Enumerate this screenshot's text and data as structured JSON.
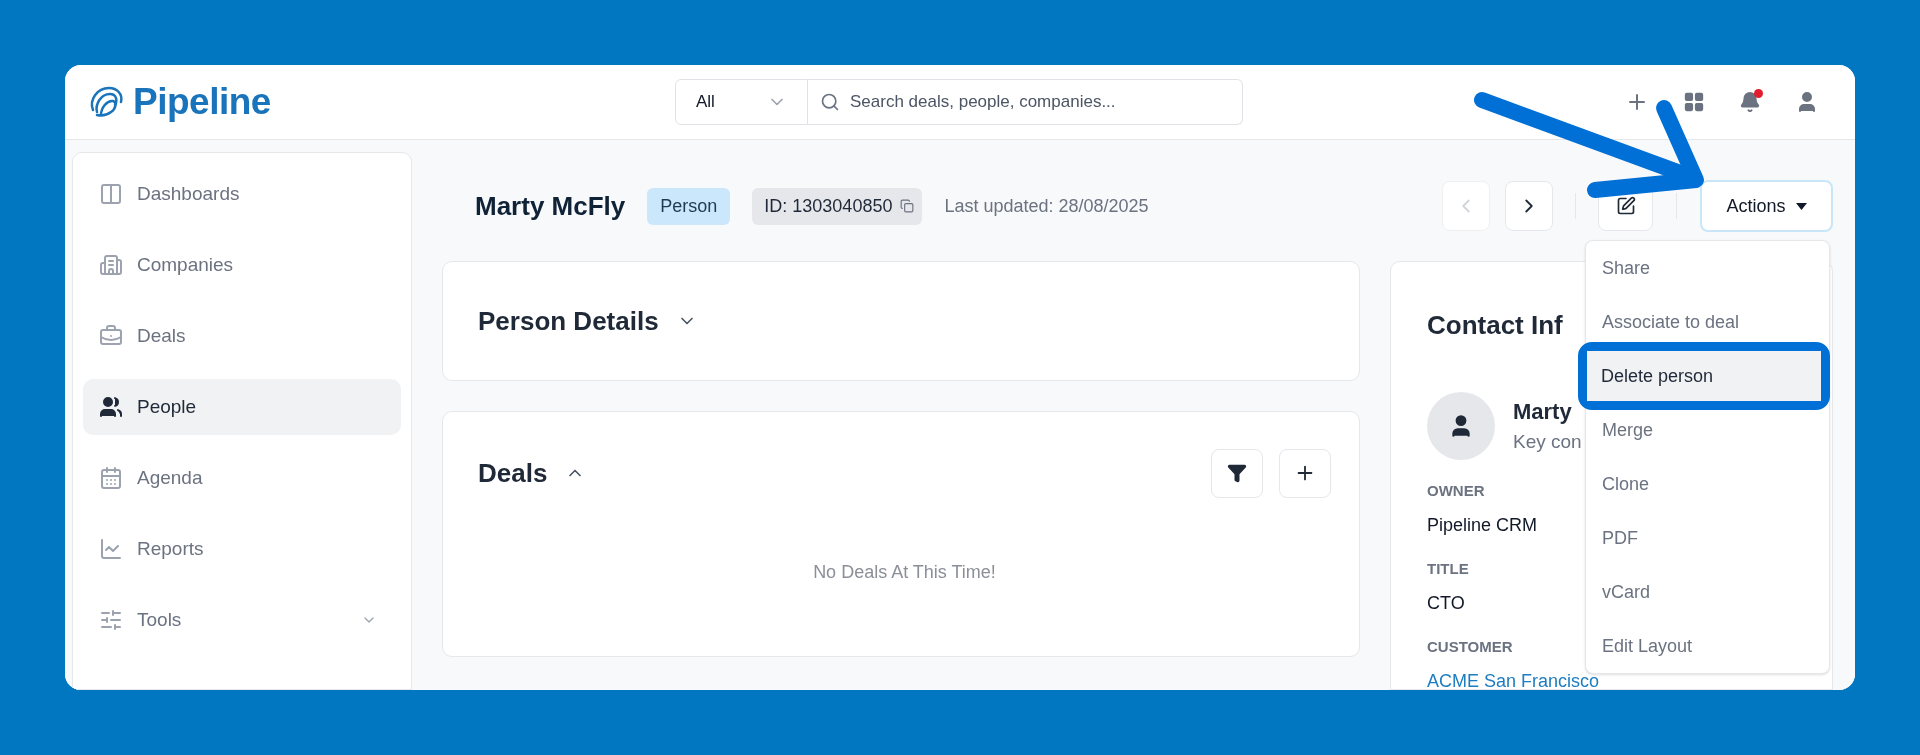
{
  "app": {
    "logo": "Pipeline"
  },
  "search": {
    "scope": "All",
    "placeholder": "Search deals, people, companies..."
  },
  "header_icons": {
    "notifications_unread": true
  },
  "sidebar": {
    "items": [
      {
        "label": "Dashboards",
        "selected": false,
        "has_submenu": false
      },
      {
        "label": "Companies",
        "selected": false,
        "has_submenu": false
      },
      {
        "label": "Deals",
        "selected": false,
        "has_submenu": false
      },
      {
        "label": "People",
        "selected": true,
        "has_submenu": false
      },
      {
        "label": "Agenda",
        "selected": false,
        "has_submenu": false
      },
      {
        "label": "Reports",
        "selected": false,
        "has_submenu": false
      },
      {
        "label": "Tools",
        "selected": false,
        "has_submenu": true
      }
    ]
  },
  "record": {
    "name": "Marty McFly",
    "type_badge": "Person",
    "id": "ID: 1303040850",
    "last_updated": "Last updated: 28/08/2025",
    "prev_disabled": true,
    "next_disabled": false
  },
  "actions": {
    "label": "Actions",
    "menu": [
      {
        "label": "Share",
        "highlighted": false
      },
      {
        "label": "Associate to deal",
        "highlighted": false
      },
      {
        "label": "Delete person",
        "highlighted": true
      },
      {
        "label": "Merge",
        "highlighted": false
      },
      {
        "label": "Clone",
        "highlighted": false
      },
      {
        "label": "PDF",
        "highlighted": false
      },
      {
        "label": "vCard",
        "highlighted": false
      },
      {
        "label": "Edit Layout",
        "highlighted": false
      }
    ]
  },
  "person_details": {
    "title": "Person Details",
    "expanded": false
  },
  "deals": {
    "title": "Deals",
    "expanded": true,
    "empty_text": "No Deals At This Time!"
  },
  "contact": {
    "title": "Contact Inf",
    "name": "Marty",
    "role": "Key con",
    "fields": [
      {
        "label": "OWNER",
        "value": "Pipeline CRM",
        "kind": "text"
      },
      {
        "label": "TITLE",
        "value": "CTO",
        "kind": "text"
      },
      {
        "label": "CUSTOMER",
        "value": "ACME San Francisco",
        "kind": "link"
      }
    ]
  },
  "annotation": {
    "arrow": true
  }
}
